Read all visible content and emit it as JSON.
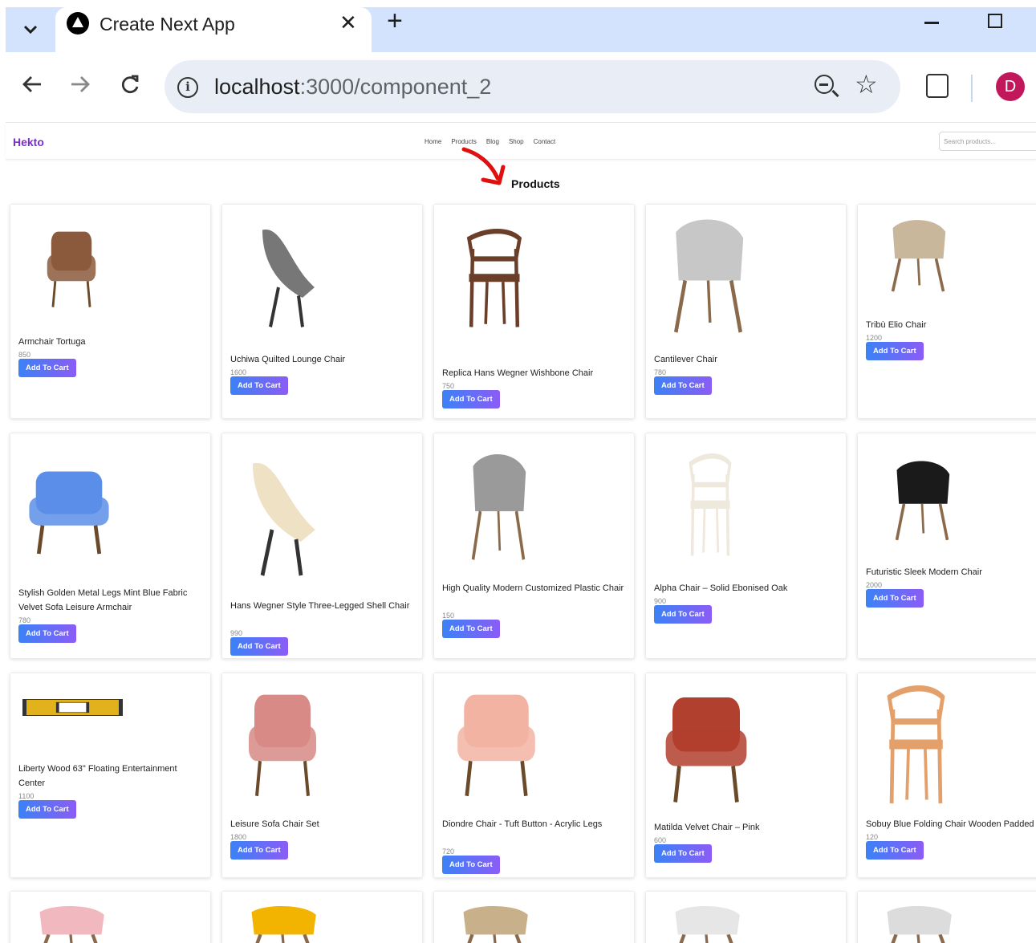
{
  "browser": {
    "tab_title": "Create Next App",
    "tab_close": "✕",
    "new_tab": "+",
    "url_host": "localhost",
    "url_path": ":3000/component_2",
    "avatar_letter": "D",
    "avatar_color": "#c2185b"
  },
  "site": {
    "logo": "Hekto",
    "logo_color": "#7b2cd6",
    "nav": [
      "Home",
      "Products",
      "Blog",
      "Shop",
      "Contact"
    ],
    "search_placeholder": "Search products...",
    "page_title": "Products",
    "button_label": "Add To Cart",
    "accent_gradient": [
      "#3b82f6",
      "#8b5cf6"
    ]
  },
  "products": [
    {
      "name": "Armchair Tortuga",
      "price": "850"
    },
    {
      "name": "Uchiwa Quilted Lounge Chair",
      "price": "1600"
    },
    {
      "name": "Replica Hans Wegner Wishbone Chair",
      "price": "750"
    },
    {
      "name": "Cantilever Chair",
      "price": "780"
    },
    {
      "name": "Tribù Elio Chair",
      "price": "1200"
    },
    {
      "name": "Stylish Golden Metal Legs Mint Blue Fabric Velvet Sofa Leisure Armchair",
      "price": "780"
    },
    {
      "name": "Hans Wegner Style Three-Legged Shell Chair",
      "price": "990"
    },
    {
      "name": "High Quality Modern Customized Plastic Chair",
      "price": "150"
    },
    {
      "name": "Alpha Chair – Solid Ebonised Oak",
      "price": "900"
    },
    {
      "name": "Futuristic Sleek Modern Chair",
      "price": "2000"
    },
    {
      "name": "Liberty Wood 63\" Floating Entertainment Center",
      "price": "1100"
    },
    {
      "name": "Leisure Sofa Chair Set",
      "price": "1800"
    },
    {
      "name": "Diondre Chair - Tuft Button - Acrylic Legs",
      "price": "720"
    },
    {
      "name": "Matilda Velvet Chair – Pink",
      "price": "600"
    },
    {
      "name": "Sobuy Blue Folding Chair Wooden Padded",
      "price": "120"
    }
  ]
}
